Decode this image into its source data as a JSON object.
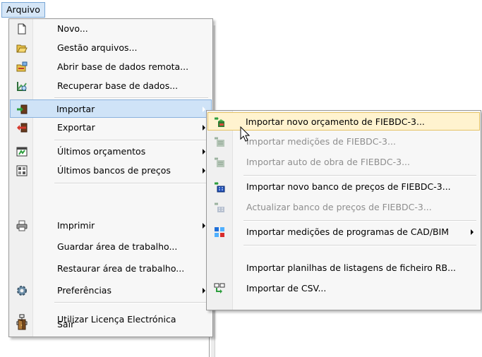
{
  "menubar": {
    "title": "Arquivo"
  },
  "menu": {
    "items": {
      "novo": "Novo...",
      "gestao": "Gestão arquivos...",
      "abrir_remota": "Abrir base de dados remota...",
      "recuperar": "Recuperar base de dados...",
      "importar": "Importar",
      "exportar": "Exportar",
      "ultimos_orc": "Últimos orçamentos",
      "ultimos_bancos": "Últimos bancos de preços",
      "imprimir": "Imprimir",
      "guardar": "Guardar área de trabalho...",
      "restaurar": "Restaurar área de trabalho...",
      "preferencias": "Preferências",
      "licenca": "Utilizar Licença Electrónica",
      "sair": "Sair"
    },
    "icons": {
      "novo": "new-document-icon",
      "gestao": "folder-open-icon",
      "abrir_remota": "remote-database-icon",
      "recuperar": "recover-database-icon",
      "importar": "import-icon",
      "exportar": "export-icon",
      "ultimos_orc": "recent-budgets-icon",
      "ultimos_bancos": "recent-price-banks-icon",
      "imprimir": "printer-icon",
      "preferencias": "gear-icon",
      "licenca": "license-network-icon",
      "sair": "exit-door-icon"
    }
  },
  "submenu": {
    "items": {
      "novo_orc": "Importar novo orçamento de FIEBDC-3...",
      "medicoes": "Importar medições de FIEBDC-3...",
      "auto_obra": "Importar auto de obra de FIEBDC-3...",
      "novo_banco": "Importar novo banco de preços de FIEBDC-3...",
      "actualizar_banco": "Actualizar banco de preços de FIEBDC-3...",
      "cad_bim": "Importar medições de programas de CAD/BIM",
      "planilhas": "Importar planilhas de listagens de ficheiro RB...",
      "csv": "Importar de CSV..."
    },
    "icons": {
      "novo_orc": "import-budget-icon",
      "medicoes": "import-measurements-icon",
      "auto_obra": "import-work-record-icon",
      "novo_banco": "import-price-bank-icon",
      "actualizar_banco": "update-price-bank-icon",
      "cad_bim": "cad-bim-icon",
      "csv": "import-csv-icon"
    }
  },
  "colors": {
    "highlight_orange": "#fff3cf",
    "highlight_blue": "#cfe3f7",
    "disabled_text": "#8e8e8e"
  }
}
